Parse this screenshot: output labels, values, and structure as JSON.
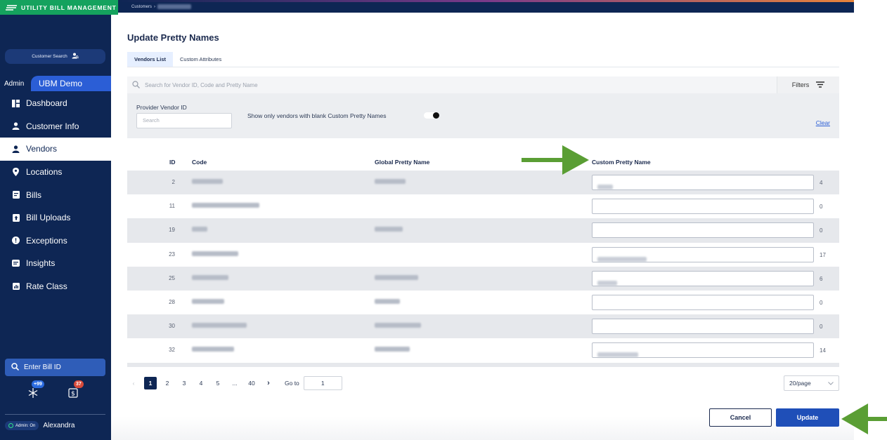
{
  "brand": {
    "name": "UTILITY BILL MANAGEMENT"
  },
  "topbar": {
    "crumb_root": "Customers",
    "crumb_sep": "›"
  },
  "sidebar": {
    "customer_search": "Customer Search",
    "role_label": "Admin",
    "account_name": "UBM Demo",
    "items": [
      {
        "label": "Dashboard",
        "icon": "dashboard-icon",
        "active": false
      },
      {
        "label": "Customer Info",
        "icon": "person-icon",
        "active": false
      },
      {
        "label": "Vendors",
        "icon": "person-icon",
        "active": true
      },
      {
        "label": "Locations",
        "icon": "location-pin-icon",
        "active": false
      },
      {
        "label": "Bills",
        "icon": "bill-icon",
        "active": false
      },
      {
        "label": "Bill Uploads",
        "icon": "upload-icon",
        "active": false
      },
      {
        "label": "Exceptions",
        "icon": "exclamation-icon",
        "active": false
      },
      {
        "label": "Insights",
        "icon": "insights-icon",
        "active": false
      },
      {
        "label": "Rate Class",
        "icon": "rate-class-icon",
        "active": false
      }
    ],
    "bill_id_placeholder": "Enter Bill ID",
    "badges": [
      {
        "icon": "asterisk-icon",
        "count": "+99",
        "color": "#2b6be0"
      },
      {
        "icon": "dollar-doc-icon",
        "count": "37",
        "color": "#d84a3a"
      }
    ],
    "admin_toggle": "Admin: On",
    "user_name": "Alexandra"
  },
  "page": {
    "title": "Update Pretty Names",
    "tabs": [
      {
        "label": "Vendors List",
        "active": true
      },
      {
        "label": "Custom Attributes",
        "active": false
      }
    ],
    "search_placeholder": "Search for Vendor ID, Code and Pretty Name",
    "filters_label": "Filters",
    "provider_vendor_id_label": "Provider Vendor ID",
    "provider_vendor_id_placeholder": "Search",
    "blank_only_label": "Show only vendors with blank Custom Pretty Names",
    "blank_only_enabled": false,
    "clear_label": "Clear"
  },
  "table": {
    "columns": {
      "id": "ID",
      "code": "Code",
      "global": "Global Pretty Name",
      "custom": "Custom Pretty Name"
    },
    "rows": [
      {
        "id": "2",
        "count": "4"
      },
      {
        "id": "11",
        "count": "0"
      },
      {
        "id": "19",
        "count": "0"
      },
      {
        "id": "23",
        "count": "17"
      },
      {
        "id": "25",
        "count": "6"
      },
      {
        "id": "28",
        "count": "0"
      },
      {
        "id": "30",
        "count": "0"
      },
      {
        "id": "32",
        "count": "14"
      }
    ]
  },
  "pagination": {
    "prev": "‹",
    "pages": [
      "1",
      "2",
      "3",
      "4",
      "5",
      "...",
      "40"
    ],
    "current": "1",
    "next": "›",
    "goto_label": "Go to",
    "goto_value": "1",
    "page_size": "20/page"
  },
  "actions": {
    "cancel": "Cancel",
    "update": "Update"
  },
  "colors": {
    "sidebar": "#0e2654",
    "brand": "#15a25e",
    "accent": "#1f4fb8",
    "annotation_arrow": "#5a9e34"
  }
}
